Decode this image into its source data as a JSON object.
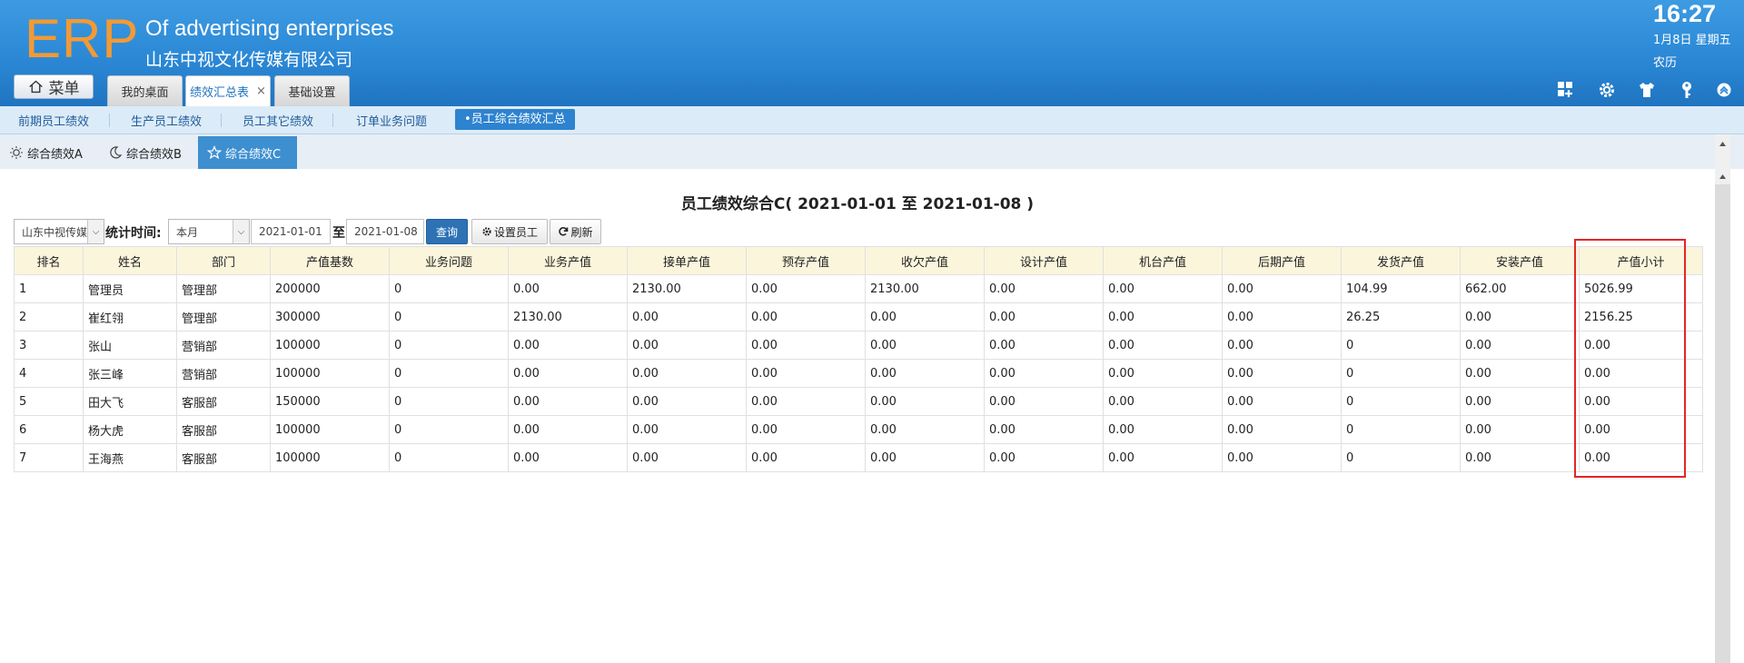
{
  "header": {
    "logo": "ERP",
    "company_en": "Of advertising enterprises",
    "company_cn": "山东中视文化传媒有限公司",
    "time": "16:27",
    "date": "1月8日 星期五",
    "lunar": "农历",
    "menu_label": "菜单",
    "tabs": [
      {
        "label": "我的桌面",
        "active": false,
        "closable": false
      },
      {
        "label": "绩效汇总表",
        "active": true,
        "closable": true
      },
      {
        "label": "基础设置",
        "active": false,
        "closable": false
      }
    ],
    "close_glyph": "×",
    "icons": [
      "grid-add-icon",
      "gear-icon",
      "shirt-icon",
      "key-icon",
      "collapse-up-icon"
    ]
  },
  "subnav": {
    "items": [
      "前期员工绩效",
      "生产员工绩效",
      "员工其它绩效",
      "订单业务问题"
    ],
    "active": "•员工综合绩效汇总"
  },
  "view_tabs": [
    {
      "label": "综合绩效A",
      "icon": "sun-icon",
      "active": false
    },
    {
      "label": "综合绩效B",
      "icon": "moon-icon",
      "active": false
    },
    {
      "label": "综合绩效C",
      "icon": "star-icon",
      "active": true
    }
  ],
  "report": {
    "title": "员工绩效综合C( 2021-01-01 至 2021-01-08 )"
  },
  "toolbar": {
    "company_select": "山东中视传媒",
    "period_label": "统计时间:",
    "period_select": "本月",
    "date_from": "2021-01-01",
    "to_label": "至",
    "date_to": "2021-01-08",
    "query_label": "查询",
    "set_staff_label": "设置员工",
    "refresh_label": "刷新"
  },
  "table": {
    "columns": [
      "排名",
      "姓名",
      "部门",
      "产值基数",
      "业务问题",
      "业务产值",
      "接单产值",
      "预存产值",
      "收欠产值",
      "设计产值",
      "机台产值",
      "后期产值",
      "发货产值",
      "安装产值",
      "产值小计"
    ],
    "rows": [
      [
        "1",
        "管理员",
        "管理部",
        "200000",
        "0",
        "0.00",
        "2130.00",
        "0.00",
        "2130.00",
        "0.00",
        "0.00",
        "0.00",
        "104.99",
        "662.00",
        "5026.99"
      ],
      [
        "2",
        "崔红翎",
        "管理部",
        "300000",
        "0",
        "2130.00",
        "0.00",
        "0.00",
        "0.00",
        "0.00",
        "0.00",
        "0.00",
        "26.25",
        "0.00",
        "2156.25"
      ],
      [
        "3",
        "张山",
        "营销部",
        "100000",
        "0",
        "0.00",
        "0.00",
        "0.00",
        "0.00",
        "0.00",
        "0.00",
        "0.00",
        "0",
        "0.00",
        "0.00"
      ],
      [
        "4",
        "张三峰",
        "营销部",
        "100000",
        "0",
        "0.00",
        "0.00",
        "0.00",
        "0.00",
        "0.00",
        "0.00",
        "0.00",
        "0",
        "0.00",
        "0.00"
      ],
      [
        "5",
        "田大飞",
        "客服部",
        "150000",
        "0",
        "0.00",
        "0.00",
        "0.00",
        "0.00",
        "0.00",
        "0.00",
        "0.00",
        "0",
        "0.00",
        "0.00"
      ],
      [
        "6",
        "杨大虎",
        "客服部",
        "100000",
        "0",
        "0.00",
        "0.00",
        "0.00",
        "0.00",
        "0.00",
        "0.00",
        "0.00",
        "0",
        "0.00",
        "0.00"
      ],
      [
        "7",
        "王海燕",
        "客服部",
        "100000",
        "0",
        "0.00",
        "0.00",
        "0.00",
        "0.00",
        "0.00",
        "0.00",
        "0.00",
        "0",
        "0.00",
        "0.00"
      ]
    ]
  },
  "colors": {
    "header_blue": "#2a86d4",
    "logo_orange": "#f29a35",
    "link_blue": "#2a69b0",
    "zero_red": "#ee0000",
    "highlight_red": "#e32626",
    "table_header_bg": "#fbf5dc"
  }
}
